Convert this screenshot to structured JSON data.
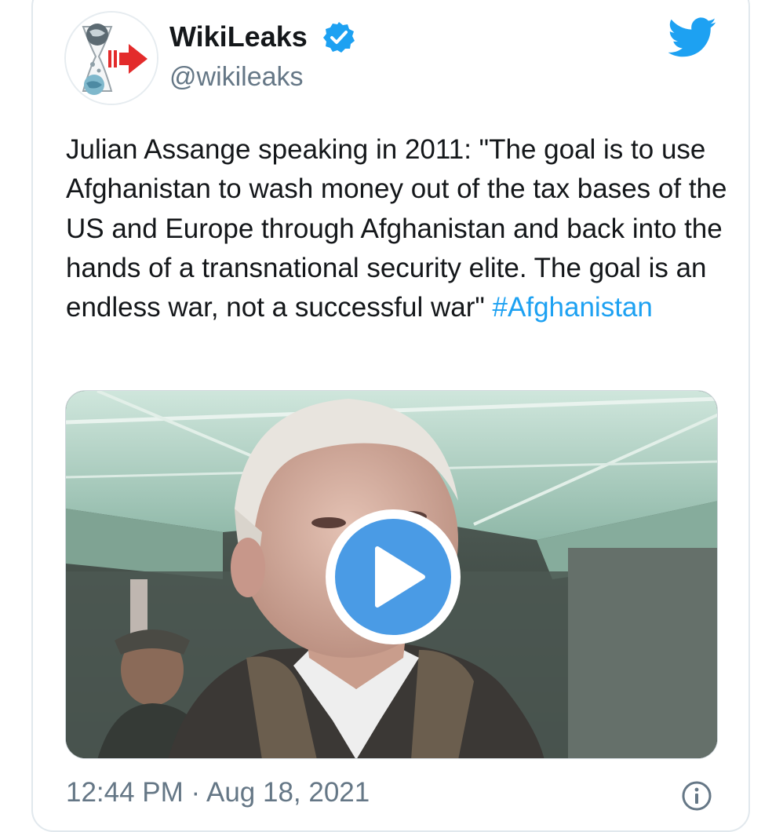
{
  "author": {
    "display_name": "WikiLeaks",
    "handle": "@wikileaks",
    "verified": true,
    "avatar_icon": "wikileaks-hourglass-logo"
  },
  "tweet": {
    "text": "Julian Assange speaking in 2011: \"The goal is to use Afghanistan to wash money out of the tax bases of the US and Europe through Afghanistan and back into the hands of a transnational security elite. The goal is an endless war, not a successful war\"",
    "hashtag": "#Afghanistan",
    "timestamp": "12:44 PM · Aug 18, 2021"
  },
  "media": {
    "type": "video",
    "play_icon": "play-button-icon"
  },
  "icons": {
    "platform": "twitter-bird-icon",
    "verified": "verified-badge-icon",
    "info": "info-icon"
  },
  "colors": {
    "twitter_blue": "#1da1f2",
    "play_blue": "#4a9be5",
    "text": "#14171a",
    "secondary_text": "#657786"
  }
}
